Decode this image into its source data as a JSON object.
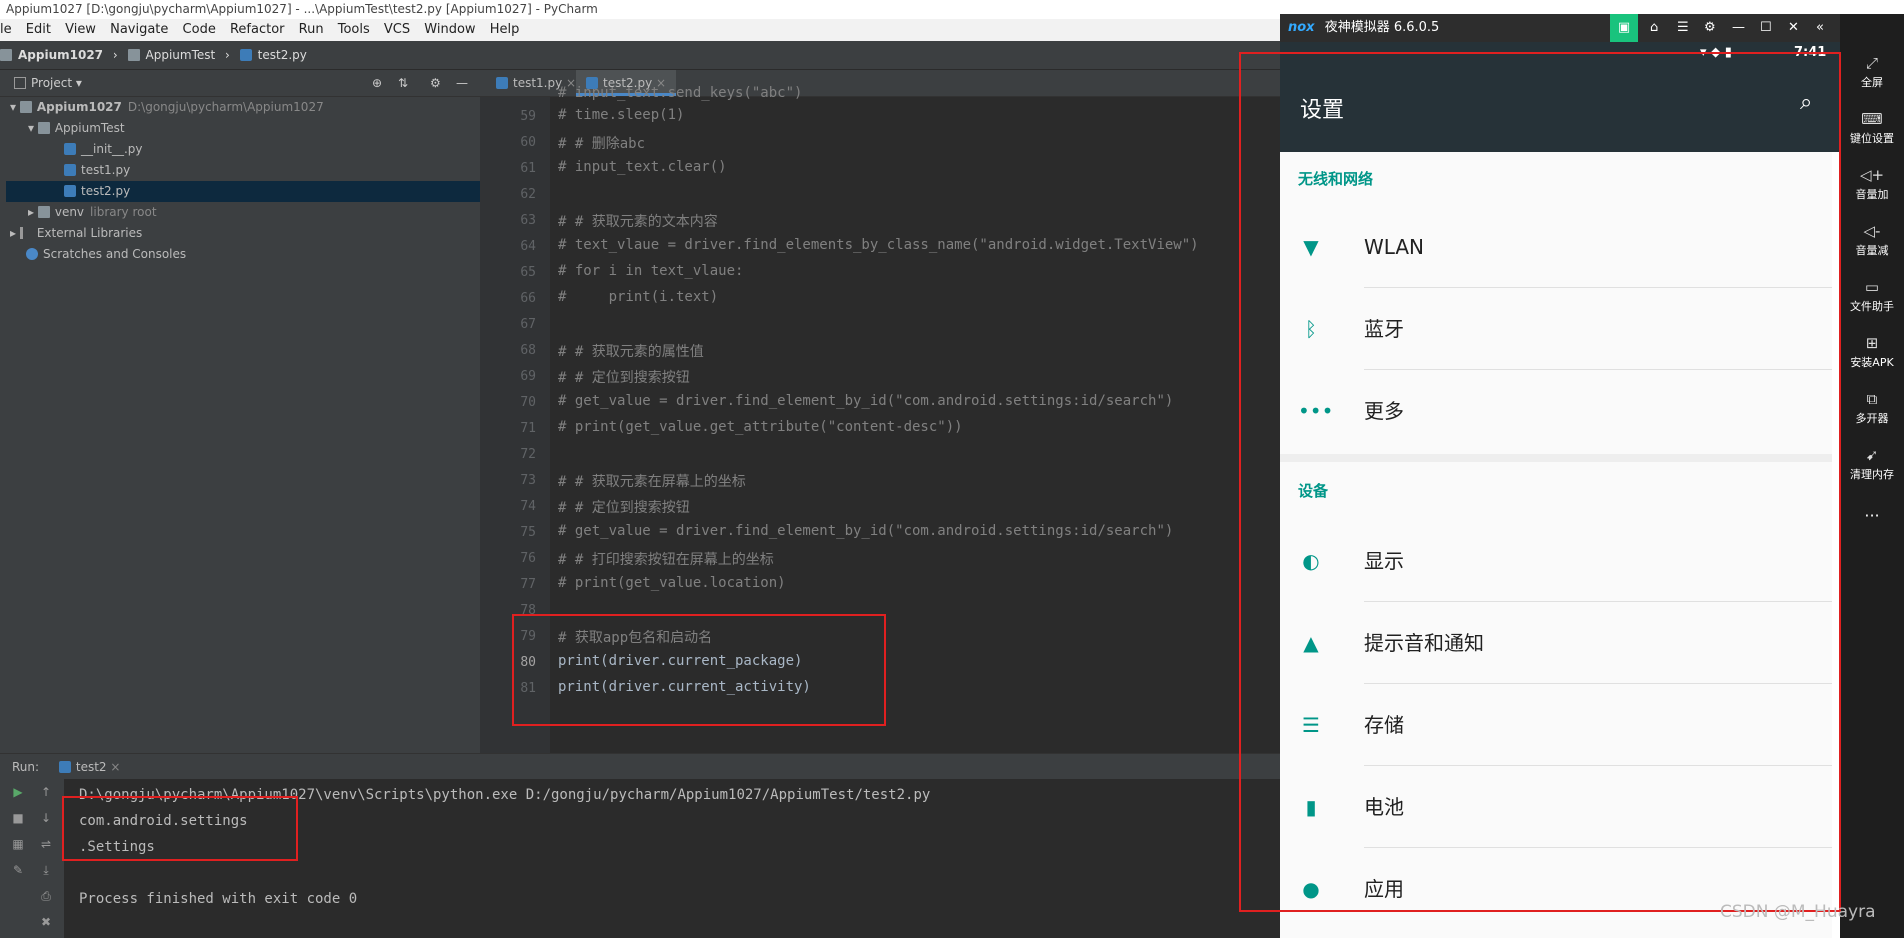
{
  "window": {
    "title": "Appium1027 [D:\\gongju\\pycharm\\Appium1027] - ...\\AppiumTest\\test2.py [Appium1027] - PyCharm"
  },
  "menu": [
    "le",
    "Edit",
    "View",
    "Navigate",
    "Code",
    "Refactor",
    "Run",
    "Tools",
    "VCS",
    "Window",
    "Help"
  ],
  "breadcrumb": [
    "Appium1027",
    "AppiumTest",
    "test2.py"
  ],
  "project": {
    "header": "Project",
    "tree": [
      {
        "label": "Appium1027",
        "extra": "D:\\gongju\\pycharm\\Appium1027"
      },
      {
        "label": "AppiumTest"
      },
      {
        "label": "__init__.py"
      },
      {
        "label": "test1.py"
      },
      {
        "label": "test2.py"
      },
      {
        "label": "venv",
        "extra": "library root"
      },
      {
        "label": "External Libraries"
      },
      {
        "label": "Scratches and Consoles"
      }
    ]
  },
  "editor": {
    "tabs": [
      "test1.py",
      "test2.py"
    ],
    "top_partial": "# input_text.send_keys(\"abc\")",
    "lines": [
      {
        "n": "59",
        "t": "# time.sleep(1)"
      },
      {
        "n": "60",
        "t": "# # 删除abc"
      },
      {
        "n": "61",
        "t": "# input_text.clear()"
      },
      {
        "n": "62",
        "t": ""
      },
      {
        "n": "63",
        "t": "# # 获取元素的文本内容"
      },
      {
        "n": "64",
        "t": "# text_vlaue = driver.find_elements_by_class_name(\"android.widget.TextView\")"
      },
      {
        "n": "65",
        "t": "# for i in text_vlaue:"
      },
      {
        "n": "66",
        "t": "#     print(i.text)"
      },
      {
        "n": "67",
        "t": ""
      },
      {
        "n": "68",
        "t": "# # 获取元素的属性值"
      },
      {
        "n": "69",
        "t": "# # 定位到搜索按钮"
      },
      {
        "n": "70",
        "t": "# get_value = driver.find_element_by_id(\"com.android.settings:id/search\")"
      },
      {
        "n": "71",
        "t": "# print(get_value.get_attribute(\"content-desc\"))"
      },
      {
        "n": "72",
        "t": ""
      },
      {
        "n": "73",
        "t": "# # 获取元素在屏幕上的坐标"
      },
      {
        "n": "74",
        "t": "# # 定位到搜索按钮"
      },
      {
        "n": "75",
        "t": "# get_value = driver.find_element_by_id(\"com.android.settings:id/search\")"
      },
      {
        "n": "76",
        "t": "# # 打印搜索按钮在屏幕上的坐标"
      },
      {
        "n": "77",
        "t": "# print(get_value.location)"
      },
      {
        "n": "78",
        "t": ""
      },
      {
        "n": "79",
        "t": "# 获取app包名和启动名"
      },
      {
        "n": "80",
        "t": "print(driver.current_package)"
      },
      {
        "n": "81",
        "t": "print(driver.current_activity)"
      }
    ]
  },
  "run": {
    "label": "Run:",
    "tab": "test2",
    "lines": [
      "D:\\gongju\\pycharm\\Appium1027\\venv\\Scripts\\python.exe D:/gongju/pycharm/Appium1027/AppiumTest/test2.py",
      "com.android.settings",
      ".Settings",
      "",
      "Process finished with exit code 0"
    ]
  },
  "emulator": {
    "brand": "nox",
    "title": "夜神模拟器 6.6.0.5",
    "time": "7:41",
    "app_title": "设置",
    "sections": [
      {
        "header": "无线和网络",
        "items": [
          {
            "label": "WLAN",
            "icon": "wifi-icon"
          },
          {
            "label": "蓝牙",
            "icon": "bluetooth-icon"
          },
          {
            "label": "更多",
            "icon": "more-dots-icon"
          }
        ]
      },
      {
        "header": "设备",
        "items": [
          {
            "label": "显示",
            "icon": "brightness-icon"
          },
          {
            "label": "提示音和通知",
            "icon": "bell-icon"
          },
          {
            "label": "存储",
            "icon": "storage-icon"
          },
          {
            "label": "电池",
            "icon": "battery-icon"
          },
          {
            "label": "应用",
            "icon": "android-icon"
          }
        ]
      }
    ],
    "sidebar": [
      "全屏",
      "键位设置",
      "音量加",
      "音量减",
      "文件助手",
      "安装APK",
      "多开器",
      "清理内存"
    ]
  },
  "watermark": "CSDN @M_Huayra"
}
